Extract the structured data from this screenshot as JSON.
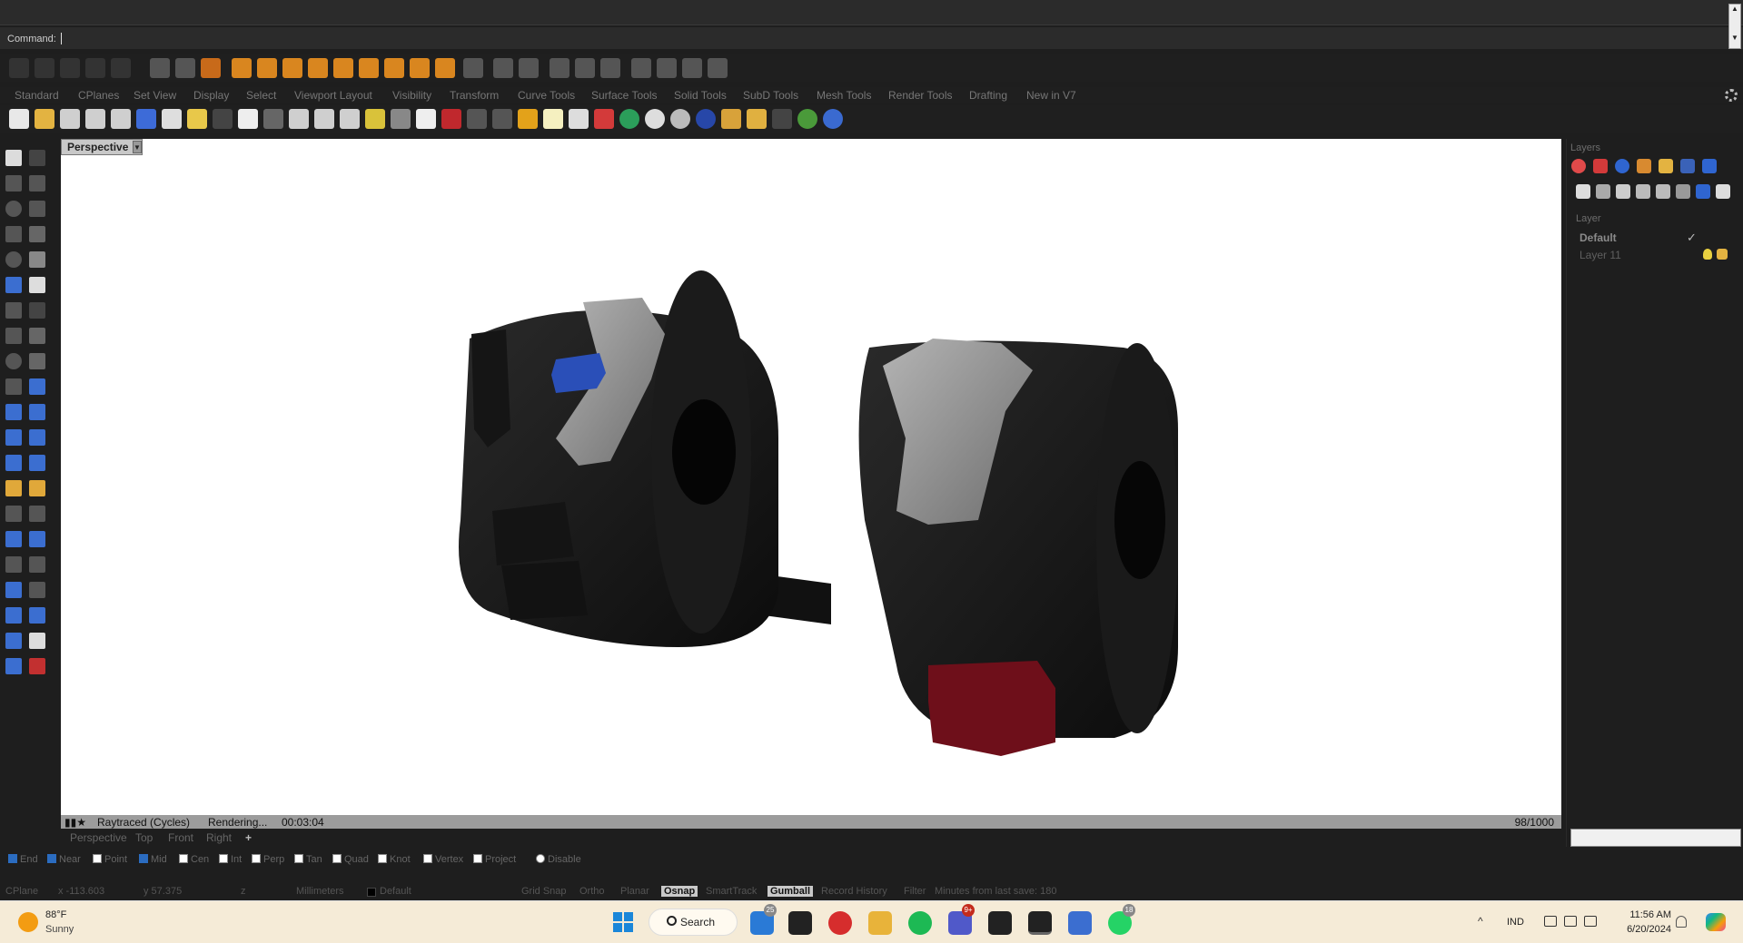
{
  "command": {
    "label": "Command:"
  },
  "top_tabs": [
    "Standard",
    "CPlanes",
    "Set View",
    "Display",
    "Select",
    "Viewport Layout",
    "Visibility",
    "Transform",
    "Curve Tools",
    "Surface Tools",
    "Solid Tools",
    "SubD Tools",
    "Mesh Tools",
    "Render Tools",
    "Drafting",
    "New in V7"
  ],
  "viewport": {
    "name": "Perspective",
    "render_mode": "Raytraced (Cycles)",
    "render_state": "Rendering...",
    "elapsed": "00:03:04",
    "progress": "98/1000",
    "tabs": [
      "Perspective",
      "Top",
      "Front",
      "Right"
    ],
    "add_tab": "+"
  },
  "layers": {
    "panel_title": "Layers",
    "column_header": "Layer",
    "items": [
      {
        "name": "Default",
        "current": true
      },
      {
        "name": "Layer 11",
        "current": false
      }
    ]
  },
  "osnap": [
    {
      "label": "End",
      "checked": true
    },
    {
      "label": "Near",
      "checked": true
    },
    {
      "label": "Point",
      "checked": false
    },
    {
      "label": "Mid",
      "checked": true
    },
    {
      "label": "Cen",
      "checked": false
    },
    {
      "label": "Int",
      "checked": false
    },
    {
      "label": "Perp",
      "checked": false
    },
    {
      "label": "Tan",
      "checked": false
    },
    {
      "label": "Quad",
      "checked": false
    },
    {
      "label": "Knot",
      "checked": false
    },
    {
      "label": "Vertex",
      "checked": false
    },
    {
      "label": "Project",
      "checked": false
    },
    {
      "label": "Disable",
      "checked": false
    }
  ],
  "status_bar": {
    "cplane": "CPlane",
    "x": "x -113.603",
    "y": "y 57.375",
    "z": "z",
    "units": "Millimeters",
    "layer": "Default",
    "grid_snap": "Grid Snap",
    "ortho": "Ortho",
    "planar": "Planar",
    "osnap": "Osnap",
    "smarttrack": "SmartTrack",
    "gumball": "Gumball",
    "record_history": "Record History",
    "filter": "Filter",
    "last_save": "Minutes from last save: 180"
  },
  "taskbar": {
    "weather_temp": "88°F",
    "weather_cond": "Sunny",
    "search_label": "Search",
    "badge_mail": "25",
    "badge_teams": "9+",
    "badge_whatsapp": "18",
    "language": "IND",
    "time": "11:56 AM",
    "date": "6/20/2024"
  },
  "colors": {
    "body_black": "#111111",
    "grip_gray": "#8e8e8e",
    "blue_button": "#2a4fb8",
    "red_button": "#6e0f1a",
    "accent_blue": "#1a86d9"
  }
}
